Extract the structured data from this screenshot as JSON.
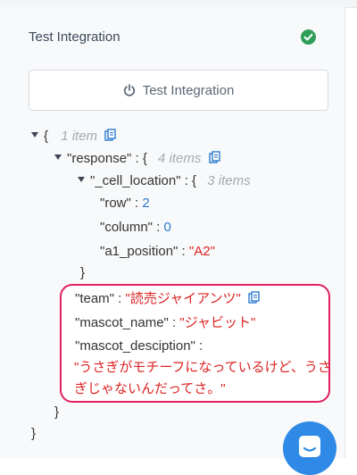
{
  "header": {
    "title": "Test Integration",
    "status_color": "#2f9e57"
  },
  "button": {
    "label": "Test Integration",
    "icon": "power-icon"
  },
  "tree": {
    "root_open": "{",
    "root_meta": "1 item",
    "response_key": "\"response\"",
    "response_sep": " : {",
    "response_meta": "4 items",
    "cell_key": "\"_cell_location\"",
    "cell_sep": " : {",
    "cell_meta": "3 items",
    "row_key": "\"row\"",
    "row_value": "2",
    "column_key": "\"column\"",
    "column_value": "0",
    "a1_key": "\"a1_position\"",
    "a1_value": "\"A2\"",
    "cell_close": "}",
    "team_key": "\"team\"",
    "team_value": "\"読売ジャイアンツ\"",
    "mascot_key": "\"mascot_name\"",
    "mascot_value": "\"ジャビット\"",
    "desc_key": "\"mascot_desciption\"",
    "desc_value": "\"うさぎがモチーフになっているけど、うさぎじゃないんだってさ。\"",
    "response_close": "}",
    "root_close": "}",
    "colon": " : "
  },
  "colors": {
    "highlight_border": "#e0205f",
    "string": "#dd2222",
    "number": "#2b7bd0",
    "chat_bubble": "#2e8ae6"
  },
  "chat": {
    "icon": "chat-icon"
  }
}
